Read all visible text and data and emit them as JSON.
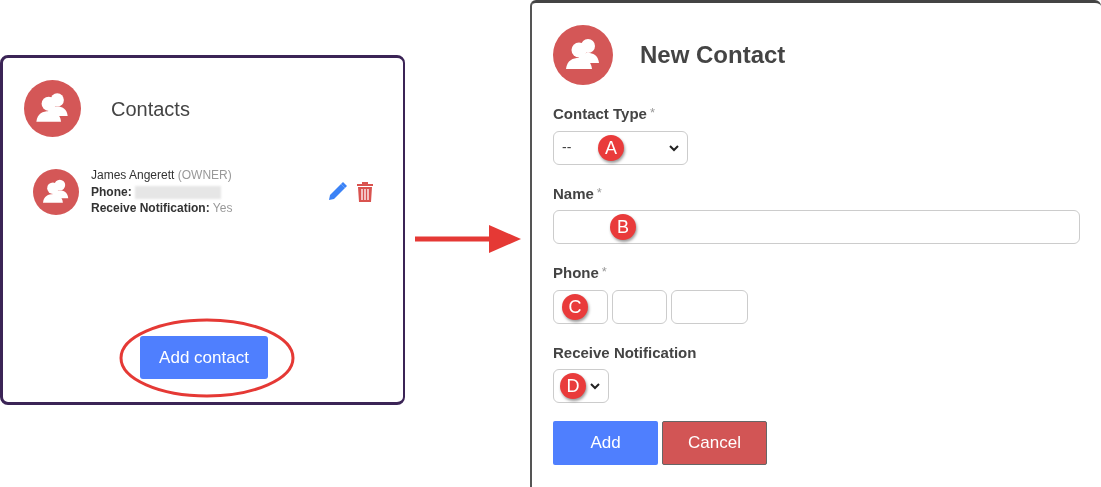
{
  "contacts_panel": {
    "title": "Contacts",
    "contacts": [
      {
        "name": "James Angerett",
        "role": "(OWNER)",
        "phone_label": "Phone:",
        "notification_label": "Receive Notification:",
        "notification_value": "Yes"
      }
    ],
    "add_button": "Add contact"
  },
  "new_contact_form": {
    "title": "New Contact",
    "fields": [
      {
        "kind": "select",
        "label": "Contact Type",
        "required_mark": "*",
        "value": "--",
        "marker": "A"
      },
      {
        "kind": "text",
        "label": "Name",
        "required_mark": "*",
        "marker": "B"
      },
      {
        "kind": "phone",
        "label": "Phone",
        "required_mark": "*",
        "marker": "C"
      },
      {
        "kind": "select",
        "label": "Receive Notification",
        "marker": "D"
      }
    ],
    "buttons": [
      {
        "label": "Add",
        "kind": "primary"
      },
      {
        "label": "Cancel",
        "kind": "danger"
      }
    ]
  }
}
